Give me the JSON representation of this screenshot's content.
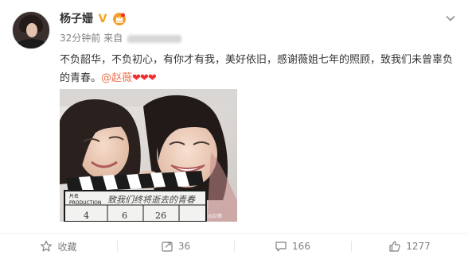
{
  "post": {
    "username": "杨子姗",
    "verified_badge": "V",
    "time": "32分钟前",
    "source_prefix": "来自",
    "text": "不负韶华，不负初心，有你才有我，美好依旧，感谢薇姐七年的照顾，致我们未曾辜负的青春。",
    "mention": "@赵薇",
    "hearts": "❤❤❤"
  },
  "photo": {
    "clapper_line1": "片名",
    "clapper_line2": "PRODUCTION",
    "clapper_handwriting": "致我们终将逝去的青春",
    "clapper_numbers": [
      "4",
      "6",
      "26"
    ],
    "watermark": "@赵薇"
  },
  "actions": {
    "favorite": "收藏",
    "repost": "36",
    "comment": "166",
    "like": "1277"
  },
  "colors": {
    "link": "#eb7350",
    "text": "#333333",
    "muted": "#808080",
    "heart": "#ef3030",
    "vip_badge": "#f3a520"
  },
  "icons": [
    "verified-icon",
    "member-crown-icon",
    "chevron-down-icon",
    "star-icon",
    "repost-icon",
    "comment-icon",
    "like-icon"
  ]
}
